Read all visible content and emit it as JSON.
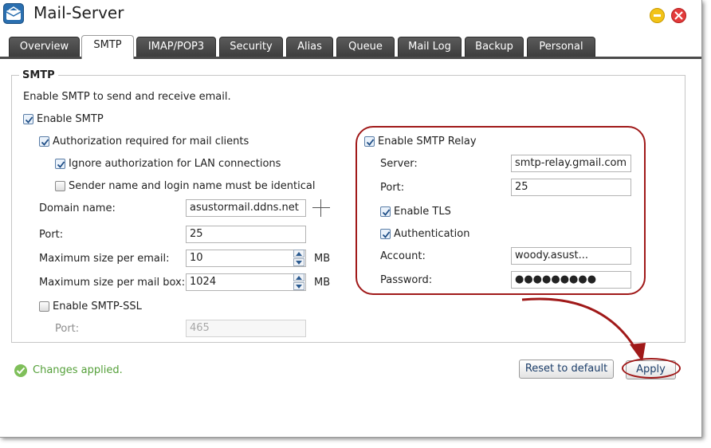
{
  "window": {
    "title": "Mail-Server"
  },
  "tabs": [
    "Overview",
    "SMTP",
    "IMAP/POP3",
    "Security",
    "Alias",
    "Queue",
    "Mail Log",
    "Backup",
    "Personal"
  ],
  "active_tab": "SMTP",
  "smtp": {
    "legend": "SMTP",
    "description": "Enable SMTP to send and receive email.",
    "enable_smtp": {
      "label": "Enable SMTP",
      "checked": true
    },
    "auth_required": {
      "label": "Authorization required for mail clients",
      "checked": true
    },
    "ignore_lan": {
      "label": "Ignore authorization for LAN connections",
      "checked": true
    },
    "sender_identical": {
      "label": "Sender name and login name must be identical",
      "checked": false
    },
    "domain": {
      "label": "Domain name:",
      "value": "asustormail.ddns.net"
    },
    "port": {
      "label": "Port:",
      "value": "25"
    },
    "max_email": {
      "label": "Maximum size per email:",
      "value": "10",
      "unit": "MB"
    },
    "max_mailbox": {
      "label": "Maximum size per mail box:",
      "value": "1024",
      "unit": "MB"
    },
    "ssl": {
      "label": "Enable SMTP-SSL",
      "checked": false,
      "port_label": "Port:",
      "port_value": "465"
    }
  },
  "relay": {
    "enable": {
      "label": "Enable SMTP Relay",
      "checked": true
    },
    "server": {
      "label": "Server:",
      "value": "smtp-relay.gmail.com"
    },
    "port": {
      "label": "Port:",
      "value": "25"
    },
    "tls": {
      "label": "Enable TLS",
      "checked": true
    },
    "auth": {
      "label": "Authentication",
      "checked": true
    },
    "account": {
      "label": "Account:",
      "value": "woody.asust..."
    },
    "password": {
      "label": "Password:",
      "value": "●●●●●●●●●"
    }
  },
  "footer": {
    "status": "Changes applied.",
    "reset_label": "Reset to default",
    "apply_label": "Apply"
  },
  "colors": {
    "annotation": "#a01919",
    "status_green": "#55a03a",
    "tab_dark": "#4a4a4a"
  }
}
